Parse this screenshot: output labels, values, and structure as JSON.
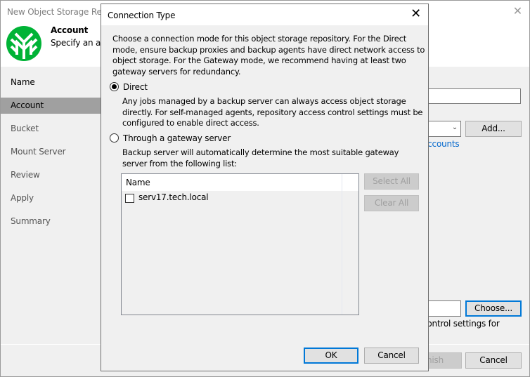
{
  "wizard": {
    "title": "New Object Storage Repository",
    "close_icon": "close-icon",
    "header": {
      "title": "Account",
      "subtitle": "Specify an account",
      "logo_icon": "veeam-logo-icon",
      "logo_color": "#00b336"
    },
    "nav": [
      {
        "label": "Name"
      },
      {
        "label": "Account",
        "active": true
      },
      {
        "label": "Bucket"
      },
      {
        "label": "Mount Server"
      },
      {
        "label": "Review"
      },
      {
        "label": "Apply"
      },
      {
        "label": "Summary"
      }
    ],
    "add_button": "Add...",
    "accounts_link": "accounts",
    "choose_button": "Choose...",
    "hint_text": "control settings for",
    "finish_button": "nish",
    "cancel_button": "Cancel"
  },
  "dialog": {
    "title": "Connection Type",
    "close_icon": "close-icon",
    "intro": "Choose a connection mode for this object storage repository. For the Direct mode, ensure backup proxies and backup agents have direct network access to object storage. For the Gateway mode, we recommend having at least two gateway servers for redundancy.",
    "options": [
      {
        "label": "Direct",
        "selected": true,
        "description": "Any jobs managed by a backup server can always access object storage directly. For self-managed agents, repository access control settings must be configured to enable direct access."
      },
      {
        "label": "Through a gateway server",
        "selected": false,
        "description": "Backup server will automatically determine the most suitable gateway server from the following list:"
      }
    ],
    "list": {
      "column_header": "Name",
      "rows": [
        {
          "label": "serv17.tech.local",
          "checked": false
        }
      ]
    },
    "select_all_button": "Select All",
    "clear_all_button": "Clear All",
    "ok_button": "OK",
    "cancel_button": "Cancel",
    "accent_color": "#0078d7"
  }
}
